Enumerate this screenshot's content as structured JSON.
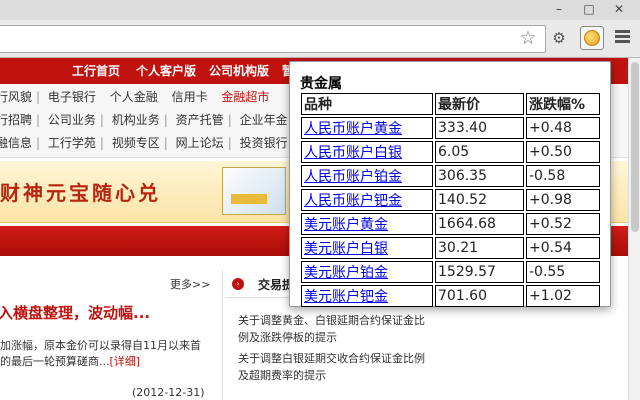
{
  "browser": {
    "extension_icon": "coin-icon",
    "star_icon": "star-icon",
    "menu_icon": "hamburger-menu-icon"
  },
  "site": {
    "top_nav": [
      "工行首页",
      "个人客户版",
      "公司机构版",
      "暂"
    ],
    "sub_nav_rows": [
      [
        "行风貌",
        "电子银行",
        "个人金融",
        "信用卡",
        "金融超市"
      ],
      [
        "行招聘",
        "公司业务",
        "机构业务",
        "资产托管",
        "企业年金"
      ],
      [
        "融信息",
        "工行学苑",
        "视频专区",
        "网上论坛",
        "投资银行"
      ]
    ],
    "banner_text": "财神元宝随心兑",
    "more_link": "更多>>",
    "headline": "入横盘整理，波动幅...",
    "summary_text": "加涨幅，原本金价可以录得自11月以来首",
    "summary_text2": "的最后一轮预算磋商...",
    "detail_link": "[详细]",
    "date": "(2012-12-31)",
    "trade_section_title": "交易提",
    "notices": [
      "关于调整黄金、白银延期合约保证金比例及涨跌停板的提示",
      "关于调整白银延期交收合约保证金比例及超期费率的提示"
    ]
  },
  "popup": {
    "title": "贵金属",
    "columns": [
      "品种",
      "最新价",
      "涨跌幅%"
    ],
    "rows": [
      {
        "name": "人民币账户黄金",
        "price": "333.40",
        "change": "+0.48"
      },
      {
        "name": "人民币账户白银",
        "price": "6.05",
        "change": "+0.50"
      },
      {
        "name": "人民币账户铂金",
        "price": "306.35",
        "change": "-0.58"
      },
      {
        "name": "人民币账户钯金",
        "price": "140.52",
        "change": "+0.98"
      },
      {
        "name": "美元账户黄金",
        "price": "1664.68",
        "change": "+0.52"
      },
      {
        "name": "美元账户白银",
        "price": "30.21",
        "change": "+0.54"
      },
      {
        "name": "美元账户铂金",
        "price": "1529.57",
        "change": "-0.55"
      },
      {
        "name": "美元账户钯金",
        "price": "701.60",
        "change": "+1.02"
      }
    ]
  },
  "colors": {
    "brand_red": "#c0120e",
    "link_blue": "#0000ee"
  }
}
